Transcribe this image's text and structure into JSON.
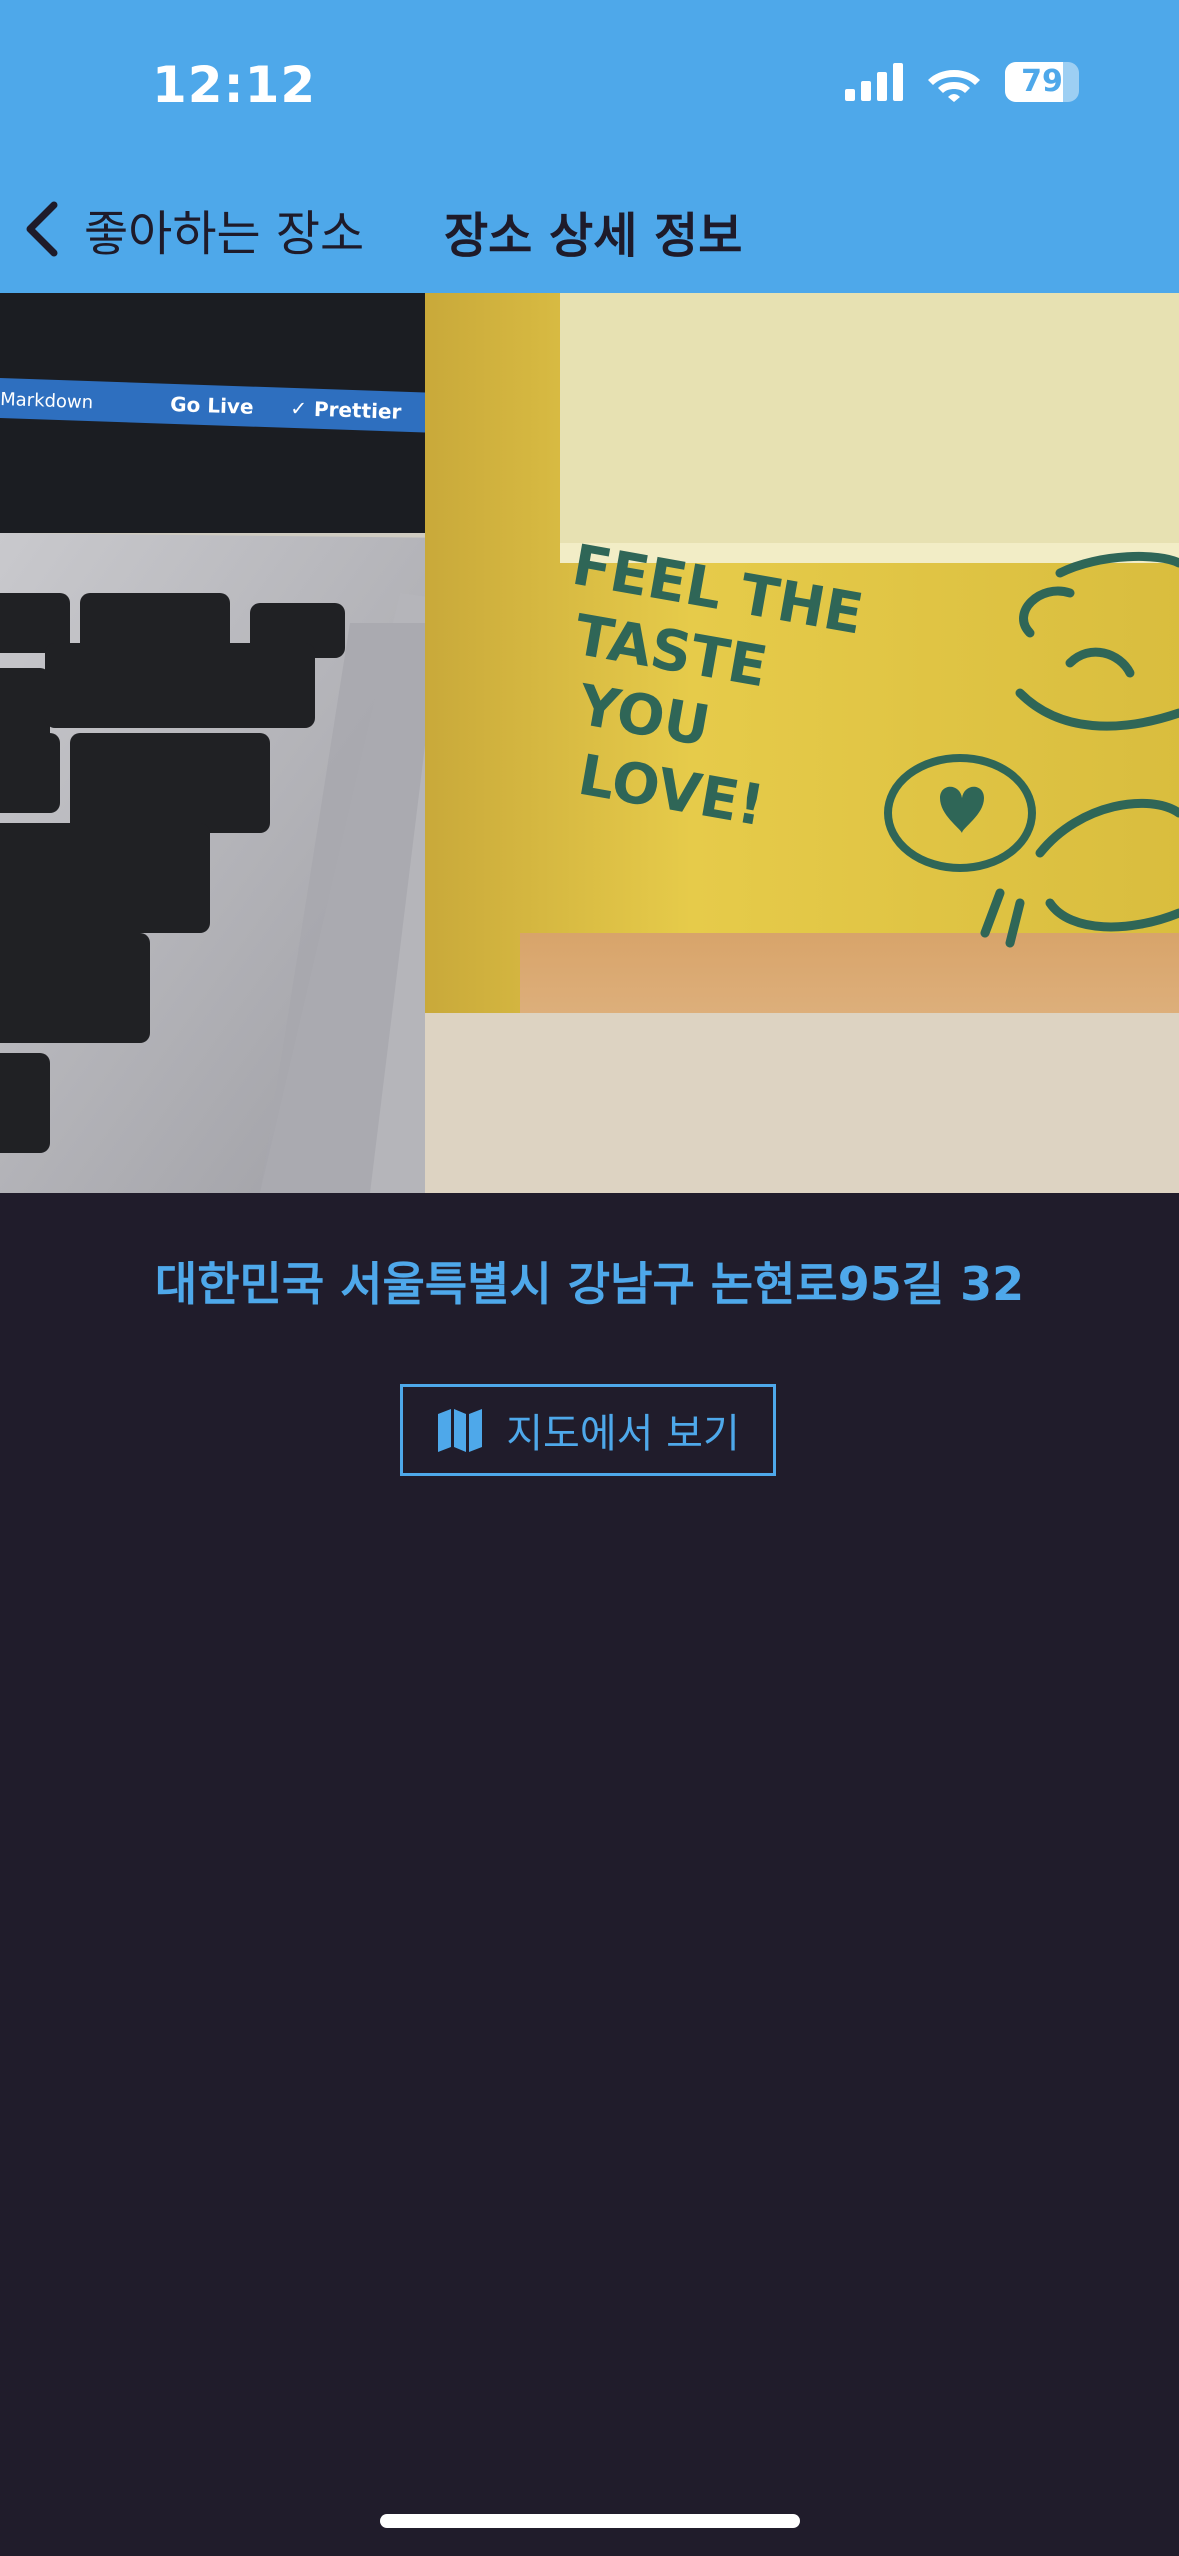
{
  "status_bar": {
    "time": "12:12",
    "battery_level": "79",
    "battery_fraction": 0.79
  },
  "nav": {
    "back_label": "좋아하는 장소",
    "title": "장소 상세 정보"
  },
  "photo": {
    "cup_text": [
      "FEEL THE",
      "TASTE",
      "YOU",
      "LOVE!"
    ],
    "editor_bar_text": [
      "Markdown",
      "Go Live",
      "✓ Prettier"
    ]
  },
  "place": {
    "address": "대한민국 서울특별시 강남구 논현로95길 32",
    "map_button_label": "지도에서 보기"
  },
  "colors": {
    "accent": "#4ea8ea",
    "background": "#201c2b",
    "header_text": "#1e1b2a"
  },
  "icons": {
    "back": "chevron-left-icon",
    "map": "map-icon",
    "signal": "cellular-signal-icon",
    "wifi": "wifi-icon",
    "battery": "battery-icon"
  }
}
